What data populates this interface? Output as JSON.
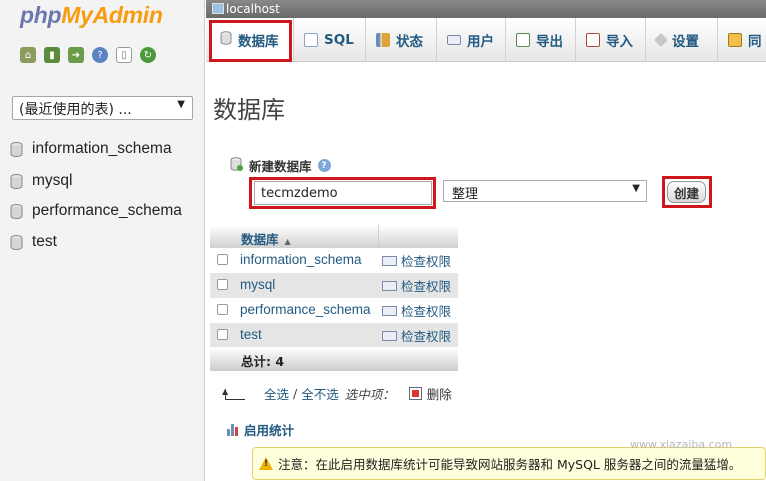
{
  "app": {
    "logo_php": "php",
    "logo_myadmin": "MyAdmin",
    "server": "localhost"
  },
  "nav": {
    "icons": [
      "home-icon",
      "exit-icon",
      "query-icon",
      "docs-icon",
      "copy-icon",
      "reload-icon"
    ],
    "recent_select": "(最近使用的表) ...",
    "databases": [
      "information_schema",
      "mysql",
      "performance_schema",
      "test"
    ]
  },
  "tabs": [
    {
      "label": "数据库",
      "icon": "database-icon",
      "active": true
    },
    {
      "label": "SQL",
      "icon": "sql-icon"
    },
    {
      "label": "状态",
      "icon": "status-icon"
    },
    {
      "label": "用户",
      "icon": "users-icon"
    },
    {
      "label": "导出",
      "icon": "export-icon"
    },
    {
      "label": "导入",
      "icon": "import-icon"
    },
    {
      "label": "设置",
      "icon": "settings-icon"
    },
    {
      "label": "同",
      "icon": "sync-icon"
    }
  ],
  "main": {
    "title": "数据库",
    "create_label": "新建数据库",
    "db_name_value": "tecmzdemo",
    "collation_value": "整理",
    "create_button": "创建",
    "table": {
      "header": "数据库",
      "rows": [
        {
          "name": "information_schema",
          "action": "检查权限"
        },
        {
          "name": "mysql",
          "action": "检查权限"
        },
        {
          "name": "performance_schema",
          "action": "检查权限"
        },
        {
          "name": "test",
          "action": "检查权限"
        }
      ],
      "total_label": "总计: 4"
    },
    "bulk": {
      "select_all": "全选",
      "separator": " / ",
      "deselect_all": "全不选",
      "with_selected": "选中项：",
      "delete": "删除"
    },
    "enable_stats": "启用统计",
    "notice": "注意：在此启用数据库统计可能导致网站服务器和 MySQL 服务器之间的流量猛增。"
  },
  "watermark": "www.xiazaiba.com",
  "colors": {
    "link": "#235a81",
    "highlight": "#d0161d",
    "logo_php": "#6c78af",
    "logo_myadmin": "#f89c0e",
    "notice_bg": "#ffffdd"
  }
}
